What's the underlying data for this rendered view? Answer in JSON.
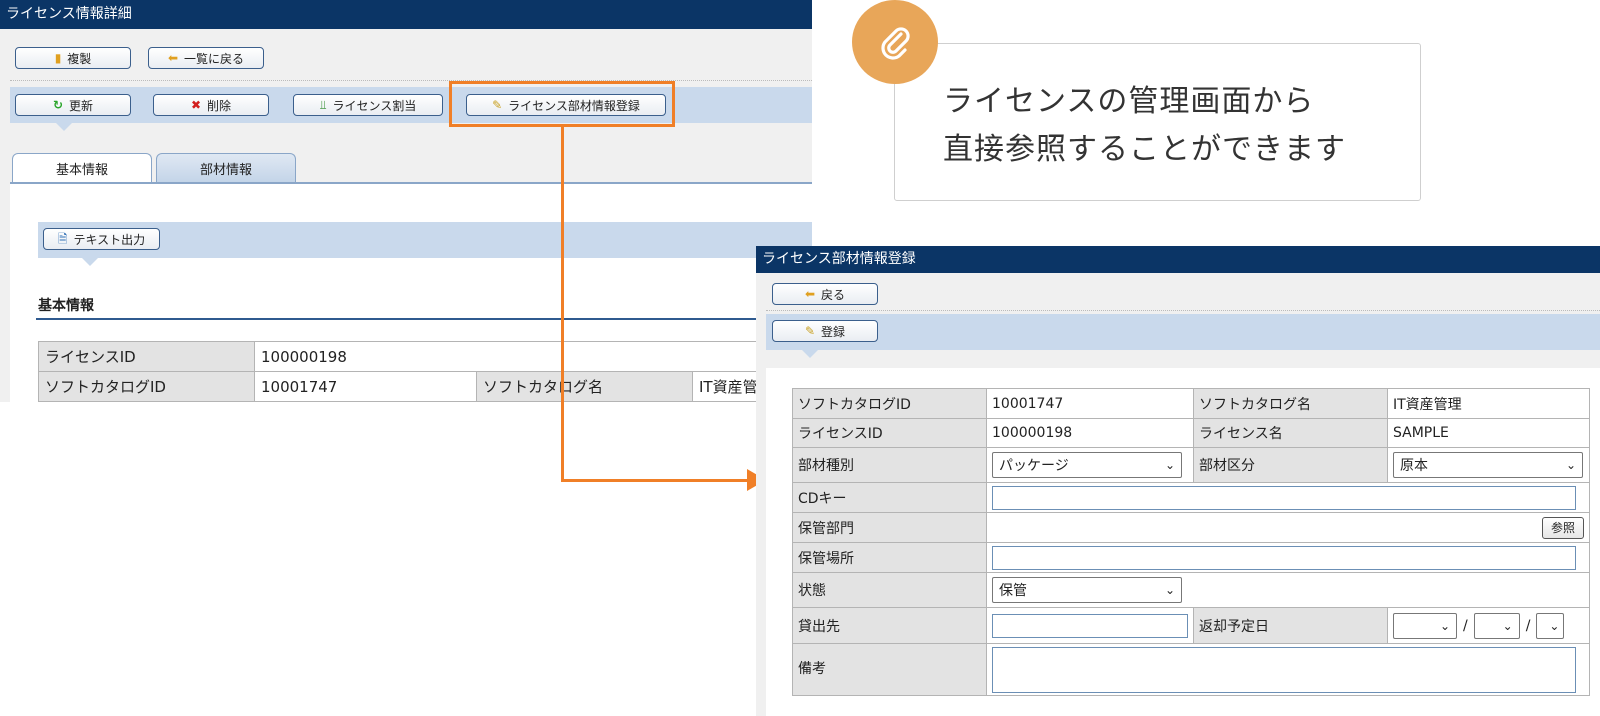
{
  "left": {
    "title": "ライセンス情報詳細",
    "toolbar1": {
      "duplicate": "複製",
      "back_to_list": "一覧に戻る"
    },
    "toolbar2": {
      "update": "更新",
      "delete": "削除",
      "license_assign": "ライセンス割当",
      "license_parts_register": "ライセンス部材情報登録"
    },
    "tabs": [
      "基本情報",
      "部材情報"
    ],
    "text_export": "テキスト出力",
    "section_title": "基本情報",
    "rows": {
      "license_id_label": "ライセンスID",
      "license_id_value": "100000198",
      "soft_catalog_id_label": "ソフトカタログID",
      "soft_catalog_id_value": "10001747",
      "soft_catalog_name_label": "ソフトカタログ名",
      "soft_catalog_name_value": "IT資産管"
    }
  },
  "callout": {
    "line1": "ライセンスの管理画面から",
    "line2": "直接参照することができます"
  },
  "right": {
    "title": "ライセンス部材情報登録",
    "back": "戻る",
    "register": "登録",
    "form": {
      "soft_catalog_id_label": "ソフトカタログID",
      "soft_catalog_id_value": "10001747",
      "soft_catalog_name_label": "ソフトカタログ名",
      "soft_catalog_name_value": "IT資産管理",
      "license_id_label": "ライセンスID",
      "license_id_value": "100000198",
      "license_name_label": "ライセンス名",
      "license_name_value": "SAMPLE",
      "part_type_label": "部材種別",
      "part_type_value": "パッケージ",
      "part_category_label": "部材区分",
      "part_category_value": "原本",
      "cd_key_label": "CDキー",
      "cd_key_value": "",
      "storage_dept_label": "保管部門",
      "storage_dept_ref": "参照",
      "storage_place_label": "保管場所",
      "storage_place_value": "",
      "status_label": "状態",
      "status_value": "保管",
      "lend_to_label": "貸出先",
      "lend_to_value": "",
      "return_date_label": "返却予定日",
      "date_sep": "/",
      "remarks_label": "備考",
      "remarks_value": ""
    }
  },
  "colors": {
    "accent_orange": "#f07f27",
    "titlebar_navy": "#0b3566",
    "badge": "#e8a659"
  }
}
